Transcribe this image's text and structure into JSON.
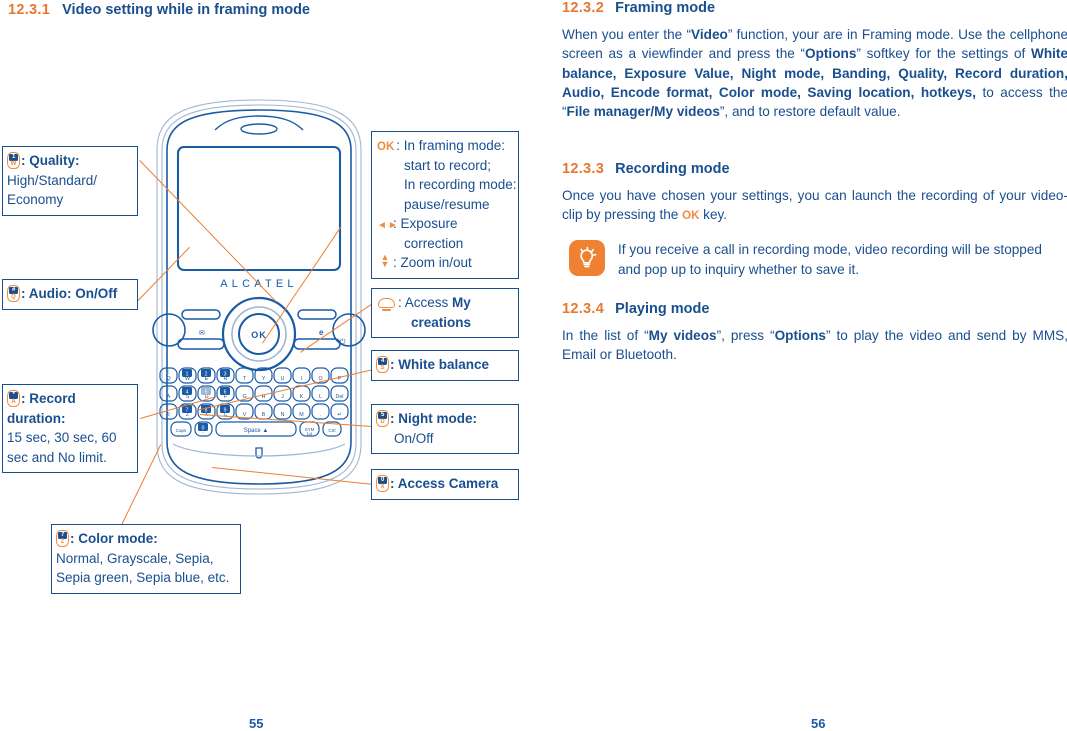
{
  "document": {
    "left_page_number": "55",
    "right_page_number": "56"
  },
  "colors": {
    "heading_number": "#e8772e",
    "heading_title": "#1a4f8f",
    "body_text": "#1a4f8f",
    "accent_orange": "#ee7e2d",
    "leader_line": "#ee7e2d",
    "callout_border": "#1a4f8f",
    "tip_icon_bg": "#ef8232"
  },
  "left_page": {
    "heading": {
      "number": "12.3.1",
      "title": "Video setting while in framing mode"
    },
    "device": {
      "brand": "ALCATEL",
      "ok_key_label": "OK",
      "space_key_label": "Space"
    },
    "callouts_left": [
      {
        "id": "quality",
        "icon": {
          "name": "key-1-w-icon",
          "top": "1",
          "bottom": "W"
        },
        "lines": [
          {
            "text": ": Quality:",
            "bold": true
          },
          {
            "text": "High/Standard/",
            "bold": false
          },
          {
            "text": "Economy",
            "bold": false
          }
        ]
      },
      {
        "id": "audio",
        "icon": {
          "name": "key-hash-q-icon",
          "top": "#",
          "bottom": "Q"
        },
        "lines": [
          {
            "text": ": Audio: On/Off",
            "bold": true
          }
        ]
      },
      {
        "id": "record-duration",
        "icon": {
          "name": "key-star-a-icon",
          "top": "*",
          "bottom": "A"
        },
        "lines": [
          {
            "text": ": Record",
            "bold": true
          },
          {
            "text": "duration:",
            "bold": true
          },
          {
            "text": "15 sec, 30 sec, 60",
            "bold": false
          },
          {
            "text": "sec and No limit.",
            "bold": false
          }
        ]
      },
      {
        "id": "color-mode",
        "icon": {
          "name": "key-7-z-icon",
          "top": "7",
          "bottom": "Z"
        },
        "lines": [
          {
            "text": ": Color mode:",
            "bold": true
          },
          {
            "text": "Normal, Grayscale, Sepia,",
            "bold": false
          },
          {
            "text": "Sepia green, Sepia blue, etc.",
            "bold": false
          }
        ]
      }
    ],
    "callouts_right": [
      {
        "id": "ok-key",
        "icon": {
          "name": "ok-key-icon",
          "glyph": "OK"
        },
        "lines": [
          {
            "text": ": In framing mode:",
            "bold": false,
            "indent": 0
          },
          {
            "text": "start to record;",
            "bold": false,
            "indent": 1
          },
          {
            "text": "In recording mode:",
            "bold": false,
            "indent": 1
          },
          {
            "text": "pause/resume",
            "bold": false,
            "indent": 1
          }
        ],
        "extra_rows": [
          {
            "icon": "left-right-arrow-icon",
            "lines": [
              ": Exposure",
              "correction"
            ]
          },
          {
            "icon": "up-down-arrow-icon",
            "lines": [
              ": Zoom in/out"
            ]
          }
        ]
      },
      {
        "id": "my-creations",
        "icon": {
          "name": "softkey-icon"
        },
        "lines": [
          {
            "text": ": Access ",
            "bold": false,
            "tail": "My",
            "tail_bold": true
          },
          {
            "text": "creations",
            "bold": true,
            "indent": 1
          }
        ]
      },
      {
        "id": "white-balance",
        "icon": {
          "name": "key-4-s-icon",
          "top": "4",
          "bottom": "S"
        },
        "lines": [
          {
            "text": ": White balance",
            "bold": true
          }
        ]
      },
      {
        "id": "night-mode",
        "icon": {
          "name": "key-5-d-icon",
          "top": "5",
          "bottom": "D"
        },
        "lines": [
          {
            "text": ": Night mode:",
            "bold": true
          },
          {
            "text": "On/Off",
            "bold": false
          }
        ]
      },
      {
        "id": "access-camera",
        "icon": {
          "name": "key-0-x-icon",
          "top": "0",
          "bottom": "X"
        },
        "lines": [
          {
            "text": ": Access Camera",
            "bold": true
          }
        ]
      }
    ]
  },
  "right_page": {
    "sections": [
      {
        "id": "framing-mode",
        "number": "12.3.2",
        "title": "Framing mode",
        "body_html": "When you enter the “<b>Video</b>” function, your are in Framing mode. Use the cellphone screen as a viewfinder and press the “<b>Options</b>” softkey for the settings of <b>White balance, Exposure Value, Night mode, Banding, Quality, Record duration, Audio, Encode format, Color mode, Saving location, hotkeys,</b> to access the “<b>File manager/My videos</b>”, and to restore default value."
      },
      {
        "id": "recording-mode",
        "number": "12.3.3",
        "title": "Recording mode",
        "body_html": "Once you have chosen your settings, you can launch the recording of your video-clip by pressing the <span class=\"okglyph\">OK</span> key."
      },
      {
        "id": "playing-mode",
        "number": "12.3.4",
        "title": "Playing mode",
        "body_html": "In the list of “<b>My videos</b>”, press “<b>Options</b>” to play the video and send by MMS, Email or Bluetooth."
      }
    ],
    "tip": {
      "icon": "lightbulb-tip-icon",
      "text": "If you receive a call in recording mode, video recording will be stopped and pop up to inquiry whether to save it."
    }
  }
}
